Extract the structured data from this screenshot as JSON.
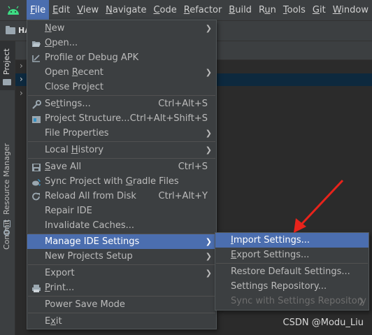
{
  "menubar": {
    "items": [
      {
        "pre": "",
        "mn": "F",
        "post": "ile",
        "active": true
      },
      {
        "pre": "",
        "mn": "E",
        "post": "dit"
      },
      {
        "pre": "",
        "mn": "V",
        "post": "iew"
      },
      {
        "pre": "",
        "mn": "N",
        "post": "avigate"
      },
      {
        "pre": "",
        "mn": "C",
        "post": "ode"
      },
      {
        "pre": "",
        "mn": "R",
        "post": "efactor"
      },
      {
        "pre": "",
        "mn": "B",
        "post": "uild"
      },
      {
        "pre": "R",
        "mn": "u",
        "post": "n"
      },
      {
        "pre": "",
        "mn": "T",
        "post": "ools"
      },
      {
        "pre": "",
        "mn": "G",
        "post": "it"
      },
      {
        "pre": "",
        "mn": "W",
        "post": "indow"
      }
    ]
  },
  "toolbar": {
    "project_name": "HA"
  },
  "left_stripe": {
    "project": "Project",
    "resource_manager": "Resource Manager",
    "commit": "Commit"
  },
  "file_menu": {
    "new": {
      "pre": "",
      "mn": "N",
      "post": "ew"
    },
    "open": {
      "pre": "",
      "mn": "O",
      "post": "pen..."
    },
    "profile": {
      "pre": "Profile or Debug APK",
      "mn": "",
      "post": ""
    },
    "open_recent": {
      "pre": "Open ",
      "mn": "R",
      "post": "ecent"
    },
    "close_project": {
      "pre": "Close Project",
      "mn": "",
      "post": ""
    },
    "settings": {
      "pre": "Se",
      "mn": "t",
      "post": "tings...",
      "shortcut": "Ctrl+Alt+S"
    },
    "project_structure": {
      "pre": "Project Structure...",
      "mn": "",
      "post": "",
      "shortcut": "Ctrl+Alt+Shift+S"
    },
    "file_properties": {
      "pre": "File Properties",
      "mn": "",
      "post": ""
    },
    "local_history": {
      "pre": "Local ",
      "mn": "H",
      "post": "istory"
    },
    "save_all": {
      "pre": "",
      "mn": "S",
      "post": "ave All",
      "shortcut": "Ctrl+S"
    },
    "sync": {
      "pre": "Sync Project with ",
      "mn": "G",
      "post": "radle Files"
    },
    "reload": {
      "pre": "Reload All from Disk",
      "mn": "",
      "post": "",
      "shortcut": "Ctrl+Alt+Y"
    },
    "repair": {
      "pre": "Repair IDE",
      "mn": "",
      "post": ""
    },
    "invalidate": {
      "pre": "Invalidate Caches...",
      "mn": "",
      "post": ""
    },
    "manage_ide": {
      "pre": "Manage IDE Settings",
      "mn": "",
      "post": ""
    },
    "new_projects_setup": {
      "pre": "New Projects Setup",
      "mn": "",
      "post": ""
    },
    "export": {
      "pre": "Export",
      "mn": "",
      "post": ""
    },
    "print": {
      "pre": "",
      "mn": "P",
      "post": "rint..."
    },
    "power_save": {
      "pre": "Power Save Mode",
      "mn": "",
      "post": ""
    },
    "exit": {
      "pre": "E",
      "mn": "x",
      "post": "it"
    }
  },
  "submenu": {
    "import": {
      "pre": "",
      "mn": "I",
      "post": "mport Settings..."
    },
    "export": {
      "pre": "",
      "mn": "E",
      "post": "xport Settings..."
    },
    "restore": {
      "pre": "Restore Default Settings...",
      "mn": "",
      "post": ""
    },
    "repository": {
      "pre": "Settings Repository...",
      "mn": "",
      "post": ""
    },
    "sync_repository": {
      "pre": "Sync with Settings Repository",
      "mn": "",
      "post": ""
    }
  },
  "watermark": "CSDN @Modu_Liu",
  "colors": {
    "highlight": "#4b6eaf",
    "menu_bg": "#3c3f41",
    "arrow_red": "#e8231b",
    "android_green": "#3ddc84"
  }
}
